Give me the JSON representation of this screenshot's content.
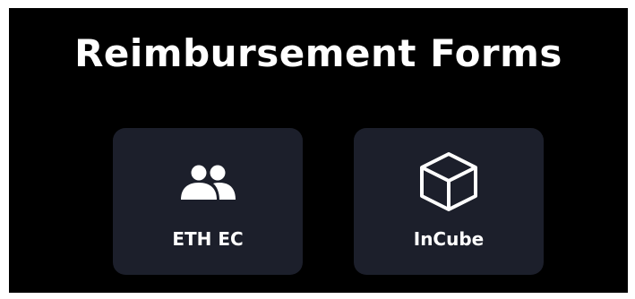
{
  "header": {
    "title": "Reimbursement Forms"
  },
  "cards": [
    {
      "label": "ETH EC",
      "icon": "people-icon"
    },
    {
      "label": "InCube",
      "icon": "cube-icon"
    }
  ],
  "colors": {
    "background": "#000000",
    "card_background": "#1c1f2b",
    "text": "#ffffff"
  }
}
